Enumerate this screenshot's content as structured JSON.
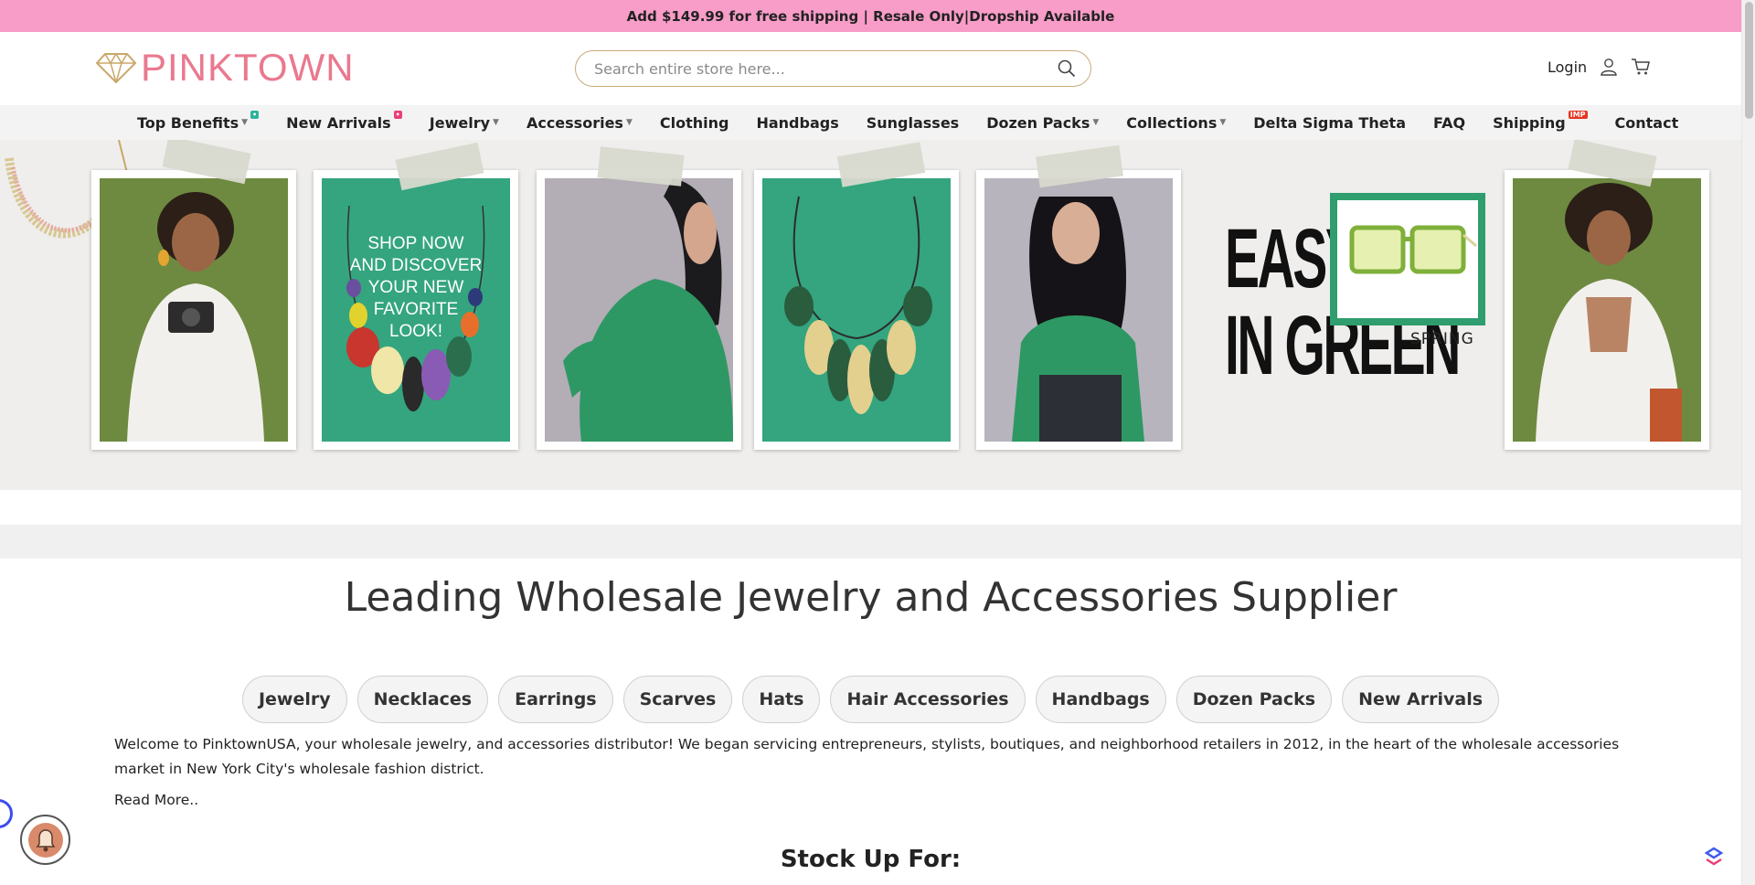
{
  "topbar": {
    "text": "Add $149.99 for free shipping | Resale Only|Dropship Available"
  },
  "header": {
    "logo_text": "PINKTOWN",
    "search_placeholder": "Search entire store here...",
    "login_label": "Login"
  },
  "nav": {
    "items": [
      {
        "label": "Top Benefits",
        "has_caret": true,
        "badge": "•",
        "badge_color": "#2bb39a"
      },
      {
        "label": "New Arrivals",
        "has_caret": false,
        "badge": "•",
        "badge_color": "#e9407a"
      },
      {
        "label": "Jewelry",
        "has_caret": true
      },
      {
        "label": "Accessories",
        "has_caret": true
      },
      {
        "label": "Clothing",
        "has_caret": false
      },
      {
        "label": "Handbags",
        "has_caret": false
      },
      {
        "label": "Sunglasses",
        "has_caret": false
      },
      {
        "label": "Dozen Packs",
        "has_caret": true
      },
      {
        "label": "Collections",
        "has_caret": true
      },
      {
        "label": "Delta Sigma Theta",
        "has_caret": false
      },
      {
        "label": "FAQ",
        "has_caret": false
      },
      {
        "label": "Shipping",
        "has_caret": false,
        "badge": "IMP",
        "badge_color": "#e8331f"
      },
      {
        "label": "Contact",
        "has_caret": false
      }
    ]
  },
  "banner": {
    "shop_text_1": "SHOP NOW",
    "shop_text_2": "AND DISCOVER",
    "shop_text_3": "YOUR NEW",
    "shop_text_4": "FAVORITE",
    "shop_text_5": "LOOK!",
    "easy_line1": "EASY",
    "easy_line2": "IN GREEN",
    "spring": "SPRING",
    "stripe_color": "#49a683"
  },
  "main": {
    "headline": "Leading Wholesale Jewelry and Accessories Supplier",
    "categories": [
      "Jewelry",
      "Necklaces",
      "Earrings",
      "Scarves",
      "Hats",
      "Hair Accessories",
      "Handbags",
      "Dozen Packs",
      "New Arrivals"
    ],
    "welcome": "Welcome to PinktownUSA, your wholesale jewelry, and accessories distributor! We began servicing entrepreneurs, stylists, boutiques, and neighborhood retailers in 2012, in the heart of the wholesale accessories market in New York City's wholesale fashion district.",
    "read_more": "Read More..",
    "stock_up": "Stock Up For:"
  },
  "colors": {
    "topbar": "#f89cc8",
    "logo": "#e9798f",
    "logo_gem": "#c9a86a",
    "accent_green": "#2f9d6e"
  }
}
